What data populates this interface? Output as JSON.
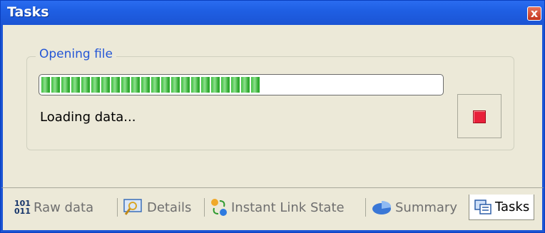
{
  "window": {
    "title": "Tasks",
    "close_label": "x"
  },
  "task": {
    "group_title": "Opening file",
    "progress_percent": 56,
    "status_text": "Loading data..."
  },
  "tabs": [
    {
      "label": "Raw data",
      "icon": "raw-data-icon",
      "active": false
    },
    {
      "label": "Details",
      "icon": "details-icon",
      "active": false
    },
    {
      "label": "Instant Link State",
      "icon": "instant-link-state-icon",
      "active": false
    },
    {
      "label": "Summary",
      "icon": "summary-icon",
      "active": false
    },
    {
      "label": "Tasks",
      "icon": "tasks-icon",
      "active": true
    }
  ],
  "raw_icon_text": {
    "top": "101",
    "bottom": "011"
  },
  "colors": {
    "titlebar": "#1f5fe3",
    "group_title": "#2456d6",
    "progress": "#3fbd3f",
    "stop": "#e8203a"
  }
}
